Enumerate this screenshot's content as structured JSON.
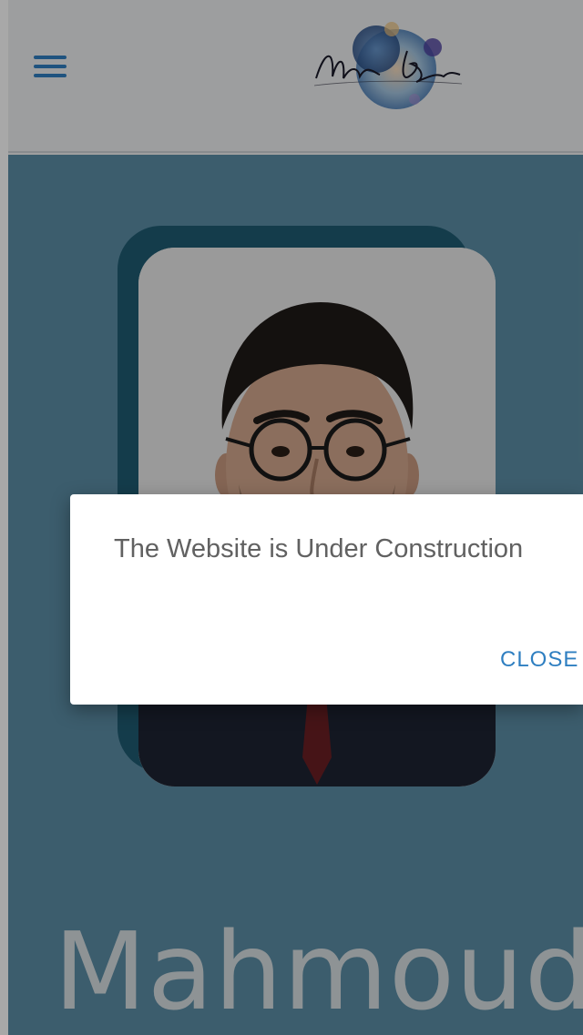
{
  "header": {
    "menu_icon": "hamburger-menu-icon",
    "logo_text": "Mahmoud Bakkar"
  },
  "hero": {
    "name": "Mahmoud",
    "photo_alt": "profile-portrait"
  },
  "dialog": {
    "message": "The Website is Under Construction",
    "close_label": "CLOSE"
  },
  "colors": {
    "accent": "#2f7fc1",
    "hero_background": "#5c8ea6",
    "photo_backplate": "#1f5b72",
    "overlay": "rgba(0,0,0,0.34)"
  }
}
